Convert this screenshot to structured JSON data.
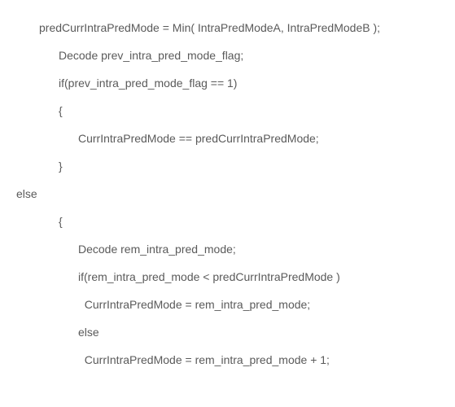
{
  "code": {
    "l1": "predCurrIntraPredMode = Min( IntraPredModeA, IntraPredModeB );",
    "l2": "Decode prev_intra_pred_mode_flag;",
    "l3": "if(prev_intra_pred_mode_flag == 1)",
    "l4": "{",
    "l5": "CurrIntraPredMode == predCurrIntraPredMode;",
    "l6": "}",
    "l7": "else",
    "l8": "{",
    "l9": "Decode rem_intra_pred_mode;",
    "l10": "if(rem_intra_pred_mode < predCurrIntraPredMode )",
    "l11": "CurrIntraPredMode = rem_intra_pred_mode;",
    "l12": "else",
    "l13": "CurrIntraPredMode = rem_intra_pred_mode + 1;"
  }
}
